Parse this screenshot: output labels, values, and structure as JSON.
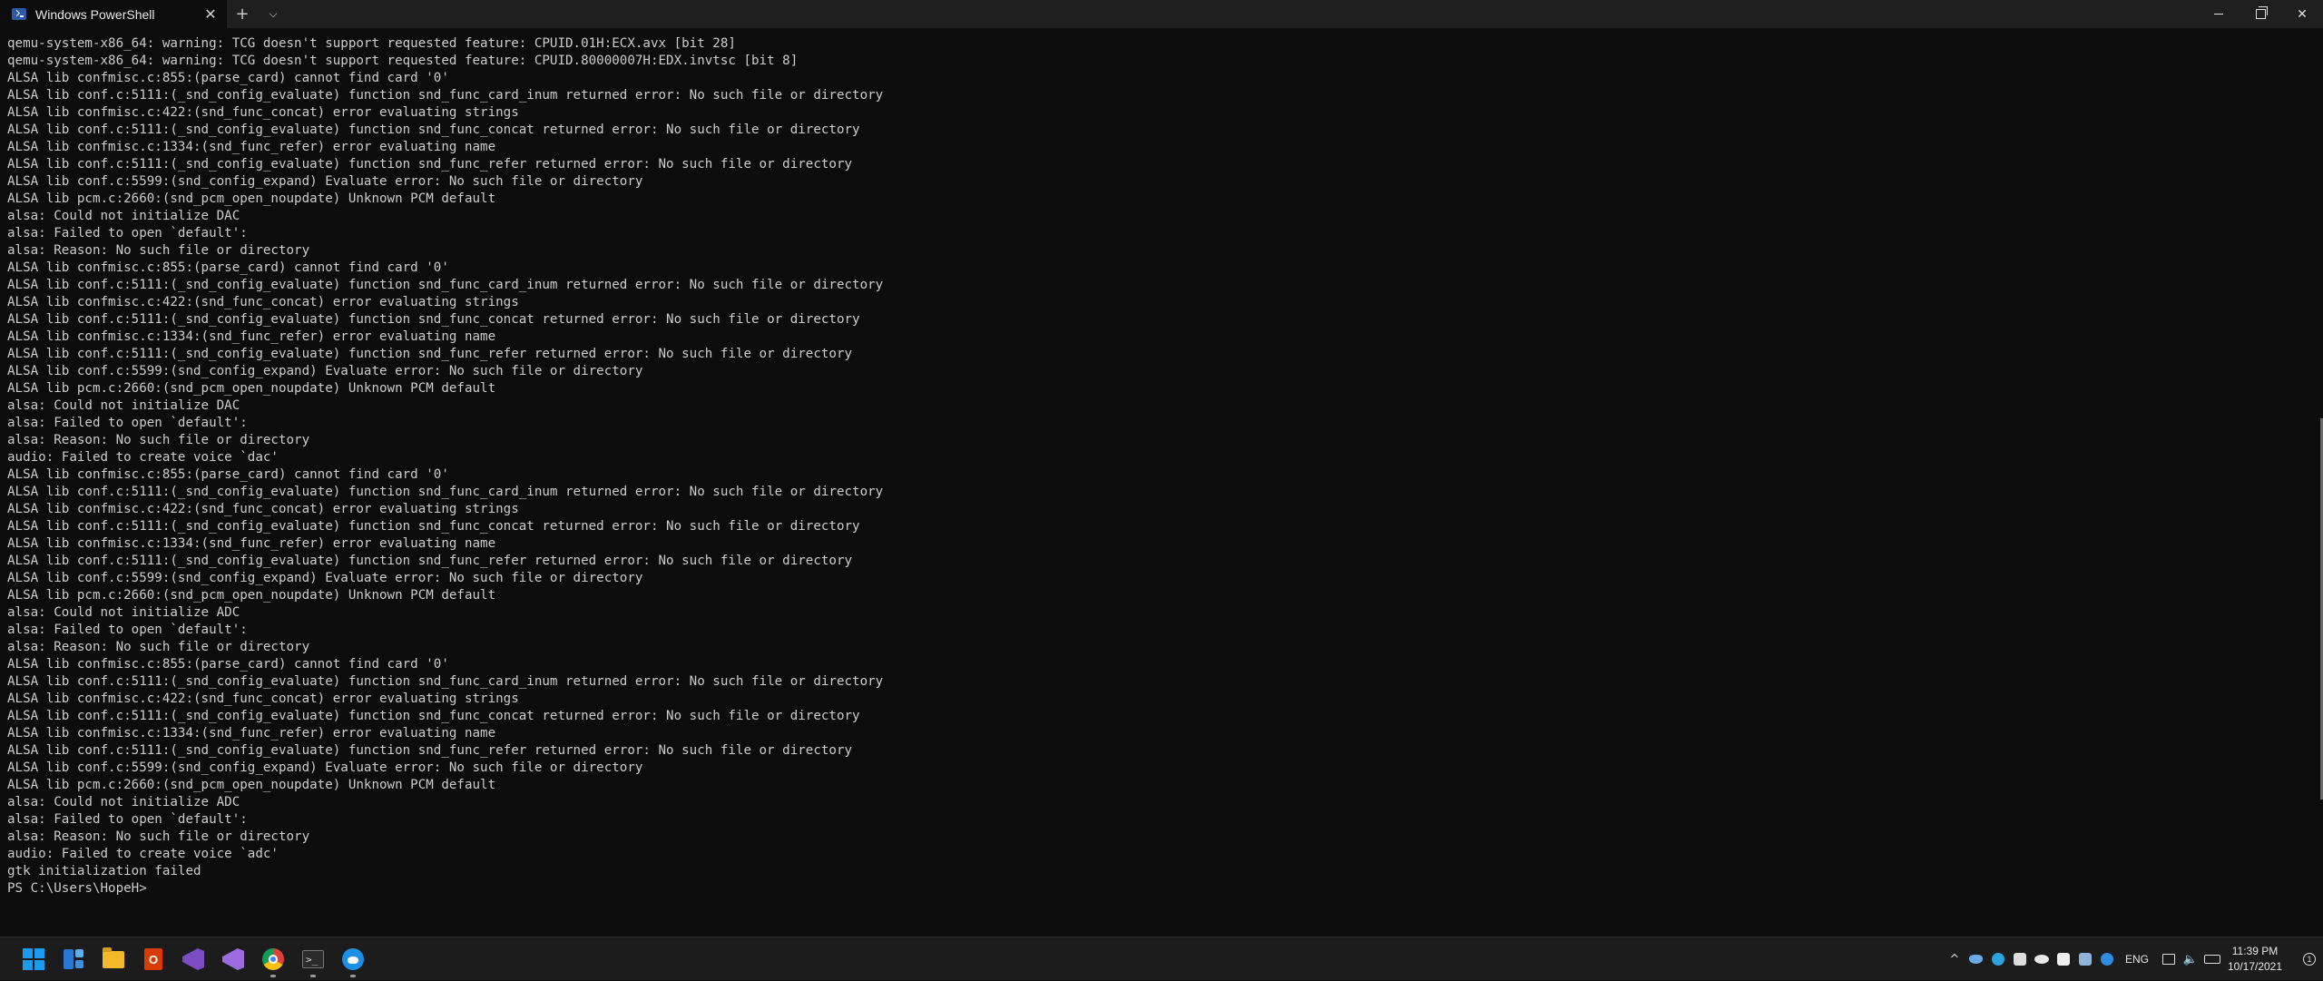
{
  "window": {
    "tab_title": "Windows PowerShell",
    "tab_close": "✕",
    "new_tab": "+",
    "dropdown": "⌵",
    "minimize": "minimize",
    "restore": "restore",
    "close": "✕"
  },
  "terminal": {
    "lines": [
      "qemu-system-x86_64: warning: TCG doesn't support requested feature: CPUID.01H:ECX.avx [bit 28]",
      "qemu-system-x86_64: warning: TCG doesn't support requested feature: CPUID.80000007H:EDX.invtsc [bit 8]",
      "ALSA lib confmisc.c:855:(parse_card) cannot find card '0'",
      "ALSA lib conf.c:5111:(_snd_config_evaluate) function snd_func_card_inum returned error: No such file or directory",
      "ALSA lib confmisc.c:422:(snd_func_concat) error evaluating strings",
      "ALSA lib conf.c:5111:(_snd_config_evaluate) function snd_func_concat returned error: No such file or directory",
      "ALSA lib confmisc.c:1334:(snd_func_refer) error evaluating name",
      "ALSA lib conf.c:5111:(_snd_config_evaluate) function snd_func_refer returned error: No such file or directory",
      "ALSA lib conf.c:5599:(snd_config_expand) Evaluate error: No such file or directory",
      "ALSA lib pcm.c:2660:(snd_pcm_open_noupdate) Unknown PCM default",
      "alsa: Could not initialize DAC",
      "alsa: Failed to open `default':",
      "alsa: Reason: No such file or directory",
      "ALSA lib confmisc.c:855:(parse_card) cannot find card '0'",
      "ALSA lib conf.c:5111:(_snd_config_evaluate) function snd_func_card_inum returned error: No such file or directory",
      "ALSA lib confmisc.c:422:(snd_func_concat) error evaluating strings",
      "ALSA lib conf.c:5111:(_snd_config_evaluate) function snd_func_concat returned error: No such file or directory",
      "ALSA lib confmisc.c:1334:(snd_func_refer) error evaluating name",
      "ALSA lib conf.c:5111:(_snd_config_evaluate) function snd_func_refer returned error: No such file or directory",
      "ALSA lib conf.c:5599:(snd_config_expand) Evaluate error: No such file or directory",
      "ALSA lib pcm.c:2660:(snd_pcm_open_noupdate) Unknown PCM default",
      "alsa: Could not initialize DAC",
      "alsa: Failed to open `default':",
      "alsa: Reason: No such file or directory",
      "audio: Failed to create voice `dac'",
      "ALSA lib confmisc.c:855:(parse_card) cannot find card '0'",
      "ALSA lib conf.c:5111:(_snd_config_evaluate) function snd_func_card_inum returned error: No such file or directory",
      "ALSA lib confmisc.c:422:(snd_func_concat) error evaluating strings",
      "ALSA lib conf.c:5111:(_snd_config_evaluate) function snd_func_concat returned error: No such file or directory",
      "ALSA lib confmisc.c:1334:(snd_func_refer) error evaluating name",
      "ALSA lib conf.c:5111:(_snd_config_evaluate) function snd_func_refer returned error: No such file or directory",
      "ALSA lib conf.c:5599:(snd_config_expand) Evaluate error: No such file or directory",
      "ALSA lib pcm.c:2660:(snd_pcm_open_noupdate) Unknown PCM default",
      "alsa: Could not initialize ADC",
      "alsa: Failed to open `default':",
      "alsa: Reason: No such file or directory",
      "ALSA lib confmisc.c:855:(parse_card) cannot find card '0'",
      "ALSA lib conf.c:5111:(_snd_config_evaluate) function snd_func_card_inum returned error: No such file or directory",
      "ALSA lib confmisc.c:422:(snd_func_concat) error evaluating strings",
      "ALSA lib conf.c:5111:(_snd_config_evaluate) function snd_func_concat returned error: No such file or directory",
      "ALSA lib confmisc.c:1334:(snd_func_refer) error evaluating name",
      "ALSA lib conf.c:5111:(_snd_config_evaluate) function snd_func_refer returned error: No such file or directory",
      "ALSA lib conf.c:5599:(snd_config_expand) Evaluate error: No such file or directory",
      "ALSA lib pcm.c:2660:(snd_pcm_open_noupdate) Unknown PCM default",
      "alsa: Could not initialize ADC",
      "alsa: Failed to open `default':",
      "alsa: Reason: No such file or directory",
      "audio: Failed to create voice `adc'",
      "gtk initialization failed",
      "PS C:\\Users\\HopeH>"
    ]
  },
  "taskbar": {
    "apps": [
      "start-icon",
      "widgets-icon",
      "file-explorer-icon",
      "office-icon",
      "visual-studio-preview-icon",
      "visual-studio-icon",
      "chrome-icon",
      "terminal-icon",
      "app-icon"
    ],
    "terminal_icon_text": ">_",
    "office_letter": "O",
    "tray": {
      "chevron": "^",
      "language": "ENG",
      "time": "11:39 PM",
      "date": "10/17/2021",
      "notification": "1"
    }
  },
  "colors": {
    "terminal_bg": "#0c0c0c",
    "terminal_text": "#cccccc",
    "titlebar_bg": "#1f1f1f",
    "taskbar_bg": "#1c1c1c",
    "accent": "#1a9bf0"
  }
}
